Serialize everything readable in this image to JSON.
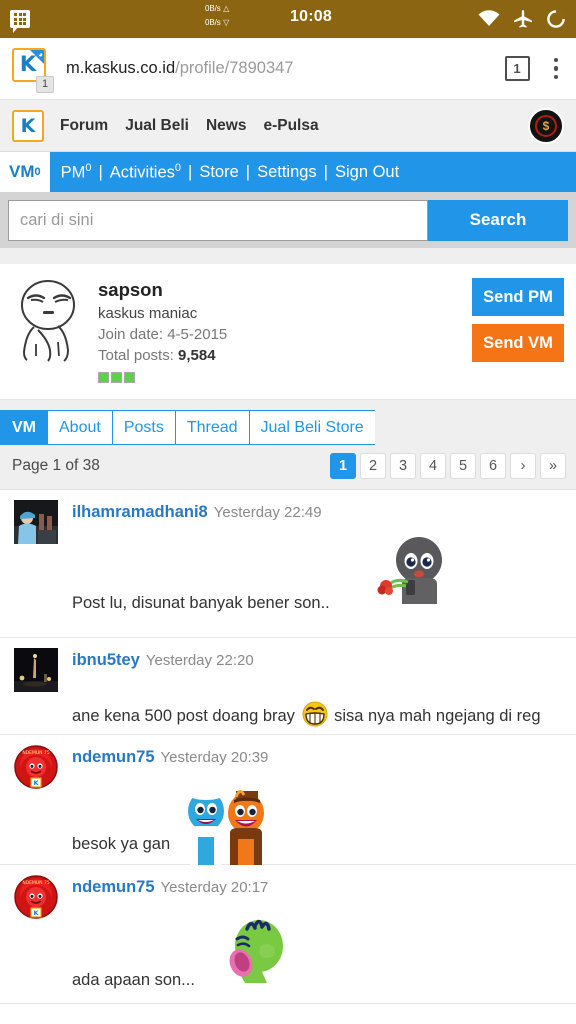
{
  "statusbar": {
    "notification_icon": "bbm-icon",
    "net_up": "0B/s",
    "net_down": "0B/s",
    "up_arrow": "△",
    "down_arrow": "▽",
    "clock": "10:08",
    "icons": [
      "wifi-icon",
      "airplane-mode-icon",
      "battery-ring-icon"
    ]
  },
  "browser": {
    "favicon_letter": "K",
    "favicon_badge": "1",
    "url_host": "m.kaskus.co.id",
    "url_path": "/profile/7890347",
    "tab_count": "1",
    "menu_icon": "kebab-menu-icon"
  },
  "sitenav": {
    "logo_letter": "K",
    "links": [
      "Forum",
      "Jual Beli",
      "News",
      "e-Pulsa"
    ],
    "avatar_label": "$"
  },
  "memberbar": {
    "vm_label": "VM",
    "vm_count": "0",
    "items": [
      {
        "label": "PM",
        "count": "0"
      },
      {
        "label": "Activities",
        "count": "0"
      },
      {
        "label": "Store",
        "count": ""
      },
      {
        "label": "Settings",
        "count": ""
      },
      {
        "label": "Sign Out",
        "count": ""
      }
    ],
    "separator": "|"
  },
  "search": {
    "placeholder": "cari di sini",
    "value": "",
    "button_label": "Search"
  },
  "profile": {
    "username": "sapson",
    "rank": "kaskus maniac",
    "join_label": "Join date:",
    "join_date": "4-5-2015",
    "posts_label": "Total posts:",
    "posts_count": "9,584",
    "reputation_bars": 3,
    "reputation_color": "#5ed14a",
    "send_pm_label": "Send PM",
    "send_vm_label": "Send VM",
    "pm_color": "#2196e8",
    "vm_color": "#f57415"
  },
  "tabs": [
    {
      "label": "VM",
      "active": true
    },
    {
      "label": "About",
      "active": false
    },
    {
      "label": "Posts",
      "active": false
    },
    {
      "label": "Thread",
      "active": false
    },
    {
      "label": "Jual Beli Store",
      "active": false
    }
  ],
  "pagination": {
    "label": "Page 1 of 38",
    "pages": [
      "1",
      "2",
      "3",
      "4",
      "5",
      "6"
    ],
    "next": "›",
    "last": "»",
    "current": "1"
  },
  "posts": [
    {
      "user": "ilhamramadhani8",
      "time": "Yesterday 22:49",
      "text": "Post lu, disunat banyak bener son..",
      "avatar": "photo-person-cap",
      "emoticon": "grey-character-with-flower",
      "emoticon_position": "float-right"
    },
    {
      "user": "ibnu5tey",
      "time": "Yesterday 22:20",
      "text_before": "ane kena 500 post doang bray",
      "text_after": "sisa nya mah ngejang di reg",
      "avatar": "photo-night-scene",
      "emoticon": "yellow-grinning-face",
      "emoticon_position": "inline"
    },
    {
      "user": "ndemun75",
      "time": "Yesterday 20:39",
      "text": "besok ya gan",
      "avatar": "red-badge-face",
      "emoticon": "blue-orange-couple",
      "emoticon_position": "float-mid"
    },
    {
      "user": "ndemun75",
      "time": "Yesterday 20:17",
      "text": "ada apaan son...",
      "avatar": "red-badge-face",
      "emoticon": "green-shouting-head",
      "emoticon_position": "float-mid"
    }
  ],
  "colors": {
    "statusbar": "#8c6512",
    "brand_blue": "#2196e8",
    "brand_orange": "#f57415",
    "link_blue": "#2878c8"
  }
}
